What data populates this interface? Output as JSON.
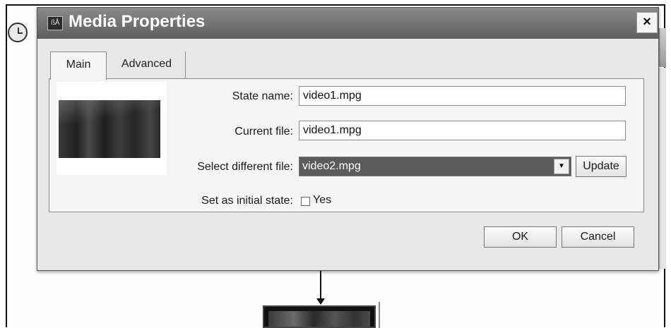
{
  "dialog": {
    "title": "Media Properties",
    "app_icon_text": "ßÅ",
    "close_label": "×"
  },
  "tabs": [
    {
      "label": "Main",
      "selected": true
    },
    {
      "label": "Advanced",
      "selected": false
    }
  ],
  "form": {
    "state_name_label": "State name:",
    "state_name_value": "video1.mpg",
    "current_file_label": "Current file:",
    "current_file_value": "video1.mpg",
    "select_file_label": "Select different file:",
    "select_file_value": "video2.mpg",
    "dropdown_arrow": "▼",
    "update_label": "Update",
    "initial_state_label": "Set as initial state:",
    "initial_state_checkbox_label": "Yes",
    "initial_state_checked": false
  },
  "buttons": {
    "ok_label": "OK",
    "cancel_label": "Cancel"
  }
}
